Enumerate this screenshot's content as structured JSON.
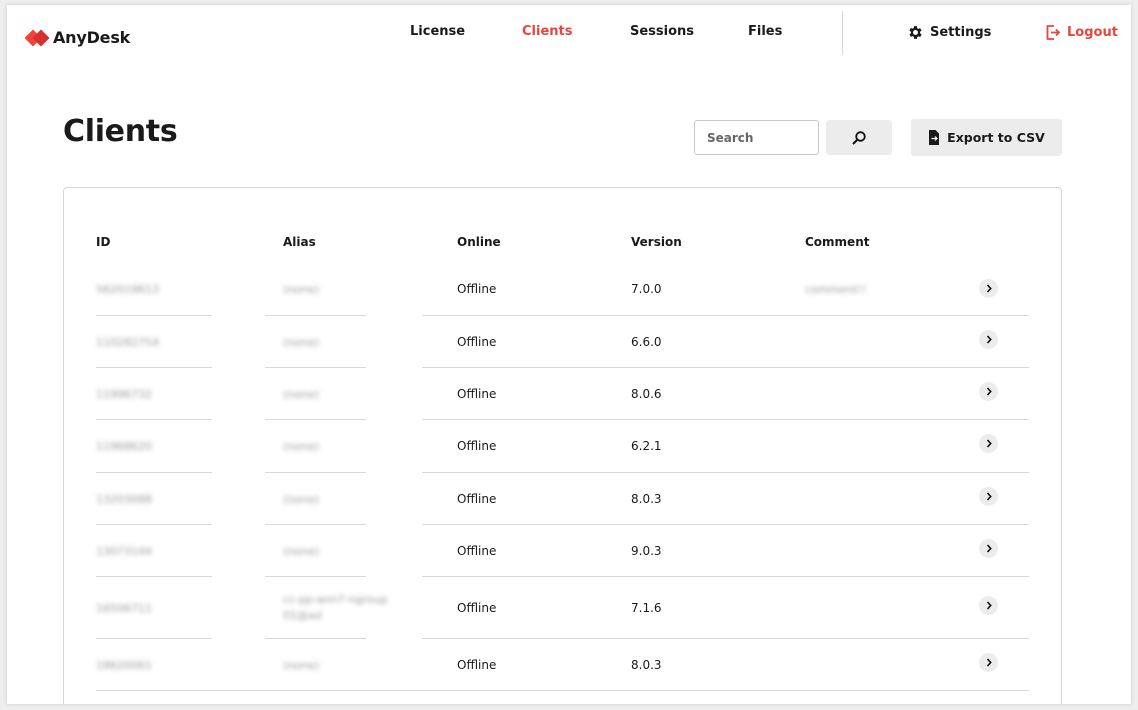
{
  "header": {
    "logo_text": "AnyDesk",
    "nav": [
      {
        "label": "License"
      },
      {
        "label": "Clients",
        "active": true
      },
      {
        "label": "Sessions"
      },
      {
        "label": "Files"
      }
    ],
    "settings_label": "Settings",
    "logout_label": "Logout",
    "accent_color": "#e2483d"
  },
  "page": {
    "title": "Clients",
    "search_placeholder": "Search",
    "search_icon": "search-icon",
    "export_label": "Export to CSV",
    "export_icon": "file-export-icon"
  },
  "table": {
    "columns": [
      "ID",
      "Alias",
      "Online",
      "Version",
      "Comment"
    ],
    "rows": [
      {
        "id": "562019613",
        "alias": "(none)",
        "online": "Offline",
        "version": "7.0.0",
        "comment": "comment!!"
      },
      {
        "id": "110282754",
        "alias": "(none)",
        "online": "Offline",
        "version": "6.6.0",
        "comment": ""
      },
      {
        "id": "11996732",
        "alias": "(none)",
        "online": "Offline",
        "version": "8.0.6",
        "comment": ""
      },
      {
        "id": "11968620",
        "alias": "(none)",
        "online": "Offline",
        "version": "6.2.1",
        "comment": ""
      },
      {
        "id": "13203088",
        "alias": "(none)",
        "online": "Offline",
        "version": "8.0.3",
        "comment": ""
      },
      {
        "id": "13073144",
        "alias": "(none)",
        "online": "Offline",
        "version": "9.0.3",
        "comment": ""
      },
      {
        "id": "16506711",
        "alias": "cc-pp-ann7-ngroup 01@ad",
        "online": "Offline",
        "version": "7.1.6",
        "comment": ""
      },
      {
        "id": "18620061",
        "alias": "(none)",
        "online": "Offline",
        "version": "8.0.3",
        "comment": ""
      }
    ]
  }
}
